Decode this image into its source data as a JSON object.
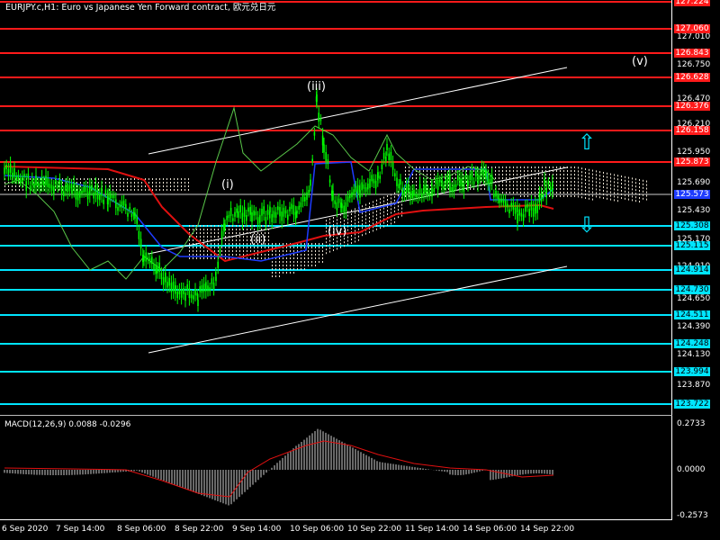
{
  "header": {
    "title": "EURJPY.c,H1:  Euro vs Japanese Yen Forward contract, 欧元兑日元"
  },
  "colors": {
    "resistance": "#ff1a1a",
    "support": "#00e5ff",
    "candle": "#00ff00",
    "channel": "#ffffff"
  },
  "price_axis": {
    "ticks": [
      "127.270",
      "127.010",
      "126.750",
      "126.470",
      "126.210",
      "125.950",
      "125.690",
      "125.430",
      "125.170",
      "124.910",
      "124.650",
      "124.390",
      "124.130",
      "123.870"
    ]
  },
  "resistance_levels": [
    "127.224",
    "127.060",
    "126.843",
    "126.628",
    "126.376",
    "126.158",
    "125.873"
  ],
  "current_price": "125.573",
  "support_levels": [
    "125.308",
    "125.115",
    "124.914",
    "124.730",
    "124.511",
    "124.248",
    "123.994",
    "123.722"
  ],
  "waves": {
    "i": "(i)",
    "ii": "(ii)",
    "iii": "(iii)",
    "iv": "(iv)",
    "v": "(v)"
  },
  "indicator": {
    "label": "MACD(12,26,9) 0.0088 -0.0296",
    "scale": [
      "0.2733",
      "0.0000",
      "-0.2573"
    ]
  },
  "time_axis": {
    "labels": [
      "6 Sep 2020",
      "7 Sep 14:00",
      "8 Sep 06:00",
      "8 Sep 22:00",
      "9 Sep 14:00",
      "10 Sep 06:00",
      "10 Sep 22:00",
      "11 Sep 14:00",
      "14 Sep 06:00",
      "14 Sep 22:00"
    ]
  },
  "chart_data": {
    "type": "line",
    "title": "",
    "xlabel": "",
    "ylabel": "",
    "ylim": [
      123.72,
      127.28
    ],
    "x": [
      "6 Sep 2020",
      "7 Sep 14:00",
      "8 Sep 06:00",
      "8 Sep 22:00",
      "9 Sep 14:00",
      "10 Sep 06:00",
      "10 Sep 22:00",
      "11 Sep 14:00",
      "14 Sep 06:00",
      "14 Sep 22:00"
    ],
    "series": [
      {
        "values": [
          125.8,
          125.55,
          125.2,
          124.75,
          125.3,
          125.55,
          125.7,
          125.6,
          125.55,
          125.6
        ]
      }
    ]
  }
}
